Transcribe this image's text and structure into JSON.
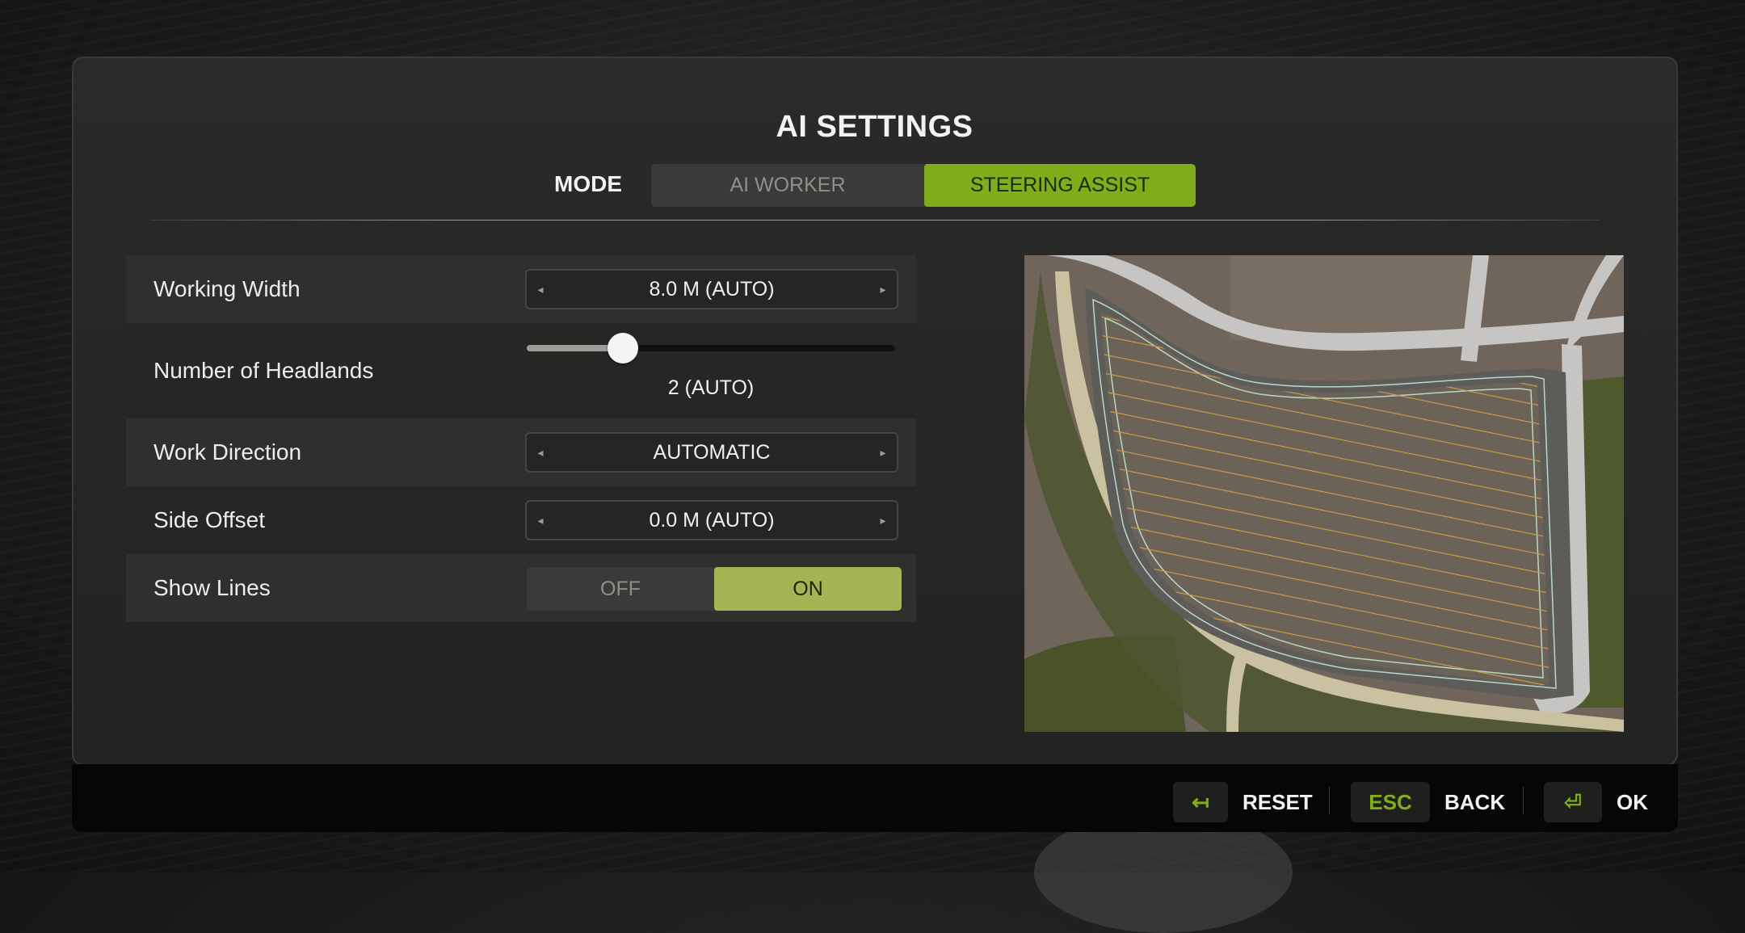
{
  "title": "AI SETTINGS",
  "mode": {
    "label": "MODE",
    "options": [
      "AI WORKER",
      "STEERING ASSIST"
    ],
    "selected": "STEERING ASSIST"
  },
  "settings": {
    "working_width": {
      "label": "Working Width",
      "value": "8.0 M (AUTO)"
    },
    "headlands": {
      "label": "Number of Headlands",
      "value": "2 (AUTO)",
      "slider_fraction": 0.26
    },
    "work_direction": {
      "label": "Work Direction",
      "value": "AUTOMATIC"
    },
    "side_offset": {
      "label": "Side Offset",
      "value": "0.0 M (AUTO)"
    },
    "show_lines": {
      "label": "Show Lines",
      "off": "OFF",
      "on": "ON",
      "selected": "ON"
    }
  },
  "icons": {
    "arrow_left": "◂",
    "arrow_right": "▸",
    "reset_key": "↤",
    "enter_key": "⏎"
  },
  "footer": {
    "reset": {
      "key": "",
      "label": "RESET"
    },
    "back": {
      "key": "ESC",
      "label": "BACK"
    },
    "ok": {
      "key": "",
      "label": "OK"
    }
  },
  "colors": {
    "accent": "#7fae1a",
    "toggle_on": "#a3b553"
  }
}
